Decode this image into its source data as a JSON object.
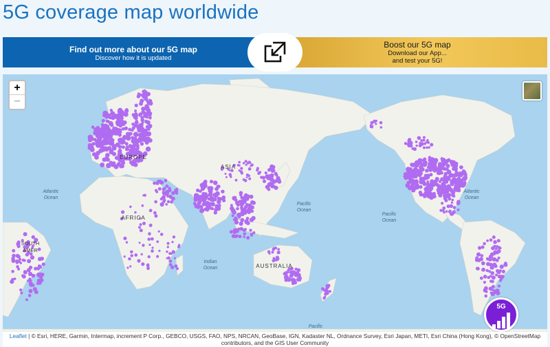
{
  "page": {
    "title": "5G coverage map worldwide"
  },
  "banner": {
    "left_line1": "Find out more about our 5G map",
    "left_line2": "Discover how it is updated",
    "right_line1": "Boost our 5G map",
    "right_line2": "Download our App...",
    "right_line3": "and test your 5G!",
    "center_icon": "expand-icon"
  },
  "map": {
    "zoom_in": "+",
    "zoom_out": "−",
    "labels": {
      "europe": "EUROPE",
      "asia": "ASIA",
      "africa": "AFRICA",
      "south_america": "SOUTH\nAMERICA",
      "australia": "AUSTRALIA",
      "atlantic_left": "Atlantic\nOcean",
      "atlantic_right": "Atlantic\nOcean",
      "indian": "Indian\nOcean",
      "pacific_1": "Pacific\nOcean",
      "pacific_2": "Pacific\nOcean",
      "pacific_3": "Pacific\nOcean"
    },
    "coverage_color": "#b06cf0",
    "ocean_color": "#a9d3ee",
    "land_color": "#f2f2ec",
    "badge_label": "5G",
    "badge_color": "#7a1fd6"
  },
  "attribution": {
    "leaflet": "Leaflet",
    "text": " | © Esri, HERE, Garmin, Intermap, increment P Corp., GEBCO, USGS, FAO, NPS, NRCAN, GeoBase, IGN, Kadaster NL, Ordnance Survey, Esri Japan, METI, Esri China (Hong Kong), © OpenStreetMap contributors, and the GIS User Community"
  }
}
